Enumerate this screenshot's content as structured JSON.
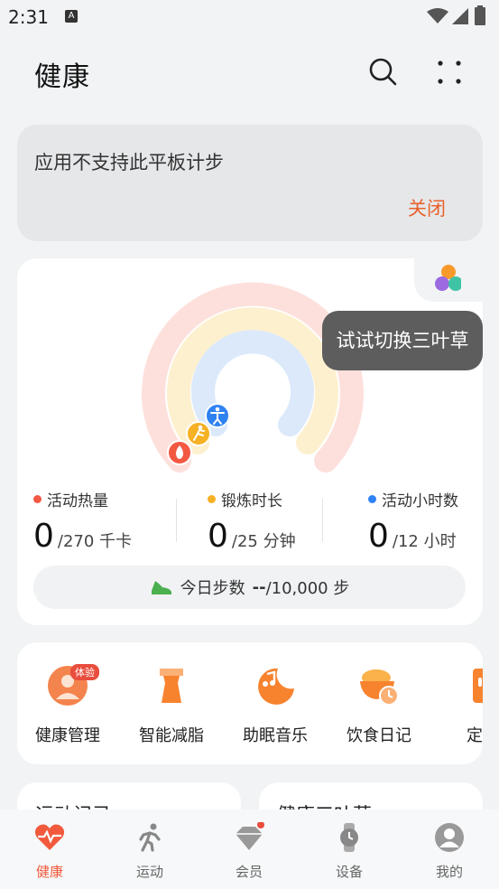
{
  "status_bar": {
    "time": "2:31",
    "a_icon": "A"
  },
  "header": {
    "title": "健康"
  },
  "banner": {
    "text": "应用不支持此平板计步",
    "close_label": "关闭"
  },
  "activity": {
    "tooltip": "试试切换三叶草",
    "rings": [
      {
        "name": "calories",
        "color": "#f35843",
        "progress": 0
      },
      {
        "name": "exercise",
        "color": "#f6b124",
        "progress": 0
      },
      {
        "name": "active_hours",
        "color": "#2f82f1",
        "progress": 0
      }
    ],
    "metrics": [
      {
        "label": "活动热量",
        "value": "0",
        "target": "/270 千卡",
        "color": "#f35843"
      },
      {
        "label": "锻炼时长",
        "value": "0",
        "target": "/25 分钟",
        "color": "#f6b124"
      },
      {
        "label": "活动小时数",
        "value": "0",
        "target": "/12 小时",
        "color": "#2f82f1"
      }
    ],
    "steps": {
      "label": "今日步数",
      "value": "--",
      "target": "/10,000 步"
    }
  },
  "features": {
    "trial_badge": "体验",
    "items": [
      {
        "label": "健康管理",
        "icon": "health-manage-icon"
      },
      {
        "label": "智能减脂",
        "icon": "fat-loss-icon"
      },
      {
        "label": "助眠音乐",
        "icon": "sleep-music-icon"
      },
      {
        "label": "饮食日记",
        "icon": "diet-diary-icon"
      },
      {
        "label": "定制",
        "icon": "custom-plan-icon"
      }
    ]
  },
  "mini_cards": [
    "运动记录",
    "健康三叶草"
  ],
  "nav": [
    {
      "label": "健康",
      "icon": "heart-pulse-icon",
      "active": true
    },
    {
      "label": "运动",
      "icon": "running-icon",
      "active": false
    },
    {
      "label": "会员",
      "icon": "diamond-icon",
      "active": false
    },
    {
      "label": "设备",
      "icon": "watch-icon",
      "active": false
    },
    {
      "label": "我的",
      "icon": "avatar-icon",
      "active": false
    }
  ],
  "colors": {
    "accent": "#f15a3c",
    "close": "#e8622d"
  }
}
